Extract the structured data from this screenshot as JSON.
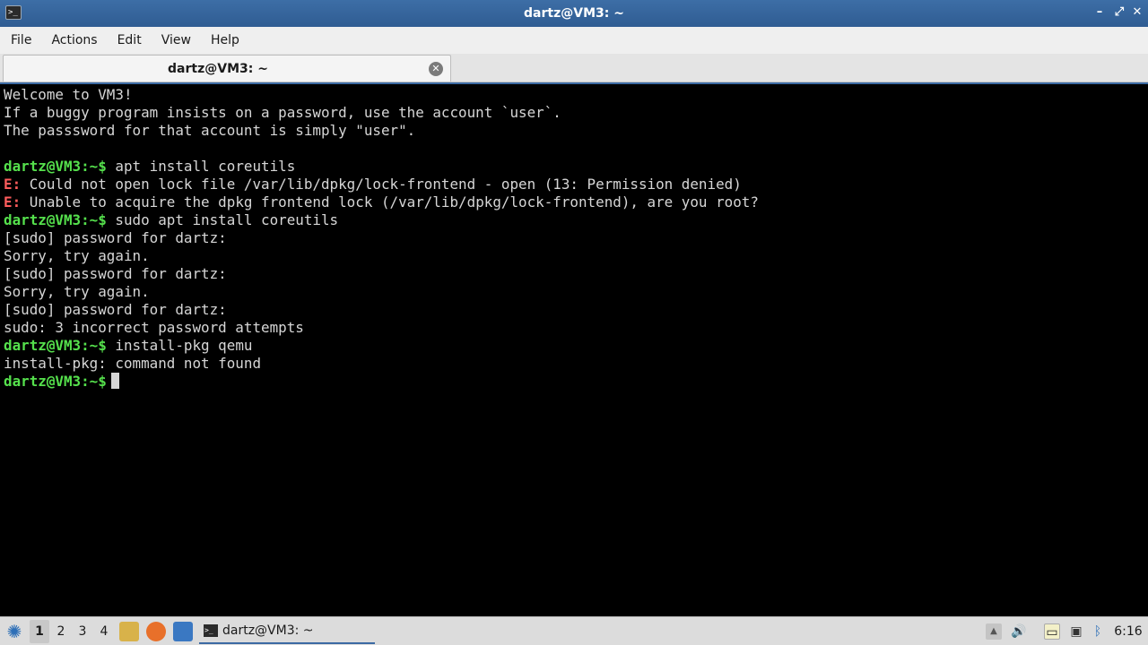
{
  "window": {
    "title": "dartz@VM3: ~",
    "app_icon_glyph": ">_",
    "minimize_glyph": "–",
    "maximize_glyph": "⤢",
    "close_glyph": "✕"
  },
  "menu": [
    "File",
    "Actions",
    "Edit",
    "View",
    "Help"
  ],
  "tab": {
    "label": "dartz@VM3: ~",
    "close_glyph": "✕"
  },
  "terminal": {
    "prompt": "dartz@VM3:~$",
    "lines": [
      {
        "text": "Welcome to VM3!"
      },
      {
        "text": "If a buggy program insists on a password, use the account `user`."
      },
      {
        "text": "The passsword for that account is simply \"user\"."
      },
      {
        "text": ""
      },
      {
        "prompt": true,
        "text": " apt install coreutils"
      },
      {
        "err": "E:",
        "text": " Could not open lock file /var/lib/dpkg/lock-frontend - open (13: Permission denied)"
      },
      {
        "err": "E:",
        "text": " Unable to acquire the dpkg frontend lock (/var/lib/dpkg/lock-frontend), are you root?"
      },
      {
        "prompt": true,
        "text": " sudo apt install coreutils"
      },
      {
        "text": "[sudo] password for dartz:"
      },
      {
        "text": "Sorry, try again."
      },
      {
        "text": "[sudo] password for dartz:"
      },
      {
        "text": "Sorry, try again."
      },
      {
        "text": "[sudo] password for dartz:"
      },
      {
        "text": "sudo: 3 incorrect password attempts"
      },
      {
        "prompt": true,
        "text": " install-pkg qemu"
      },
      {
        "text": "install-pkg: command not found"
      },
      {
        "prompt": true,
        "text": "",
        "cursor": true
      }
    ]
  },
  "taskbar": {
    "start_glyph": "✺",
    "workspaces": [
      "1",
      "2",
      "3",
      "4"
    ],
    "active_workspace": "1",
    "launchers": [
      {
        "name": "file-manager-icon",
        "color": "#d8b24a"
      },
      {
        "name": "firefox-icon",
        "color": "#e8702a"
      },
      {
        "name": "show-desktop-icon",
        "color": "#3a78c2"
      }
    ],
    "task": {
      "label": "dartz@VM3: ~",
      "icon_glyph": ">_"
    },
    "tray": [
      {
        "name": "tray-up-arrow-icon",
        "glyph": "▲"
      },
      {
        "name": "volume-icon",
        "glyph": "🔊"
      },
      {
        "name": "clipboard-icon",
        "glyph": "▭"
      },
      {
        "name": "network-icon",
        "glyph": "▣"
      },
      {
        "name": "bluetooth-icon",
        "glyph": "ᛒ"
      }
    ],
    "clock": "6:16"
  }
}
